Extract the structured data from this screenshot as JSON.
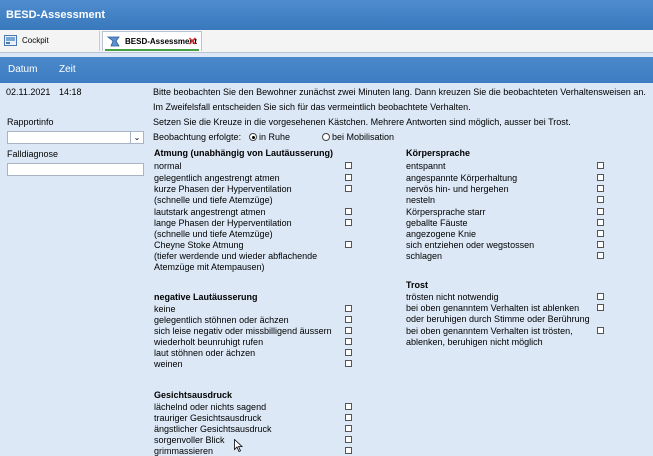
{
  "window": {
    "title": "BESD-Assessment"
  },
  "tabs": [
    {
      "label": "Cockpit"
    },
    {
      "label": "BESD-Assessment"
    }
  ],
  "header": {
    "datum_label": "Datum",
    "zeit_label": "Zeit"
  },
  "left": {
    "date_value": "02.11.2021",
    "time_value": "14:18",
    "rapportinfo_label": "Rapportinfo",
    "falldiagnose_label": "Falldiagnose"
  },
  "instructions": [
    "Bitte beobachten Sie den Bewohner zunächst zwei Minuten lang. Dann kreuzen Sie die beobachteten Verhaltensweisen an.",
    "Im Zweifelsfall entscheiden Sie sich für das vermeintlich beobachtete Verhalten.",
    "Setzen Sie die Kreuze in die vorgesehenen Kästchen. Mehrere Antworten sind möglich, ausser bei Trost."
  ],
  "observation": {
    "label": "Beobachtung erfolgte:",
    "option_rest": "in Ruhe",
    "option_mobil": "bei Mobilisation",
    "selected": "in Ruhe"
  },
  "sections": {
    "atmung": {
      "title": "Atmung (unabhängig von Lautäusserung)",
      "items": [
        "normal",
        "gelegentlich angestrengt atmen",
        "kurze Phasen der Hyperventilation",
        "(schnelle und tiefe Atemzüge)",
        "lautstark angestrengt atmen",
        "lange Phasen der Hyperventilation",
        "(schnelle und tiefe Atemzüge)",
        "Cheyne Stoke Atmung",
        "(tiefer werdende und wieder abflachende",
        "Atemzüge mit Atempausen)"
      ]
    },
    "laut": {
      "title": "negative Lautäusserung",
      "items": [
        "keine",
        "gelegentlich stöhnen oder ächzen",
        "sich leise negativ oder missbilligend äussern",
        "wiederholt beunruhigt rufen",
        "laut stöhnen oder ächzen",
        "weinen"
      ]
    },
    "gesicht": {
      "title": "Gesichtsausdruck",
      "items": [
        "lächelnd oder nichts sagend",
        "trauriger Gesichtsausdruck",
        "ängstlicher Gesichtsausdruck",
        "sorgenvoller Blick",
        "grimmassieren"
      ]
    },
    "koerper": {
      "title": "Körpersprache",
      "items": [
        "entspannt",
        "angespannte Körperhaltung",
        "nervös hin- und hergehen",
        "nesteln",
        "Körpersprache starr",
        "geballte Fäuste",
        "angezogene Knie",
        "sich entziehen oder wegstossen",
        "schlagen"
      ]
    },
    "trost": {
      "title": "Trost",
      "items": [
        "trösten nicht notwendig",
        "bei oben genanntem Verhalten ist ablenken",
        "oder beruhigen durch Stimme oder Berührung",
        "bei oben genanntem Verhalten ist trösten,",
        "ablenken, beruhigen nicht möglich"
      ]
    }
  }
}
